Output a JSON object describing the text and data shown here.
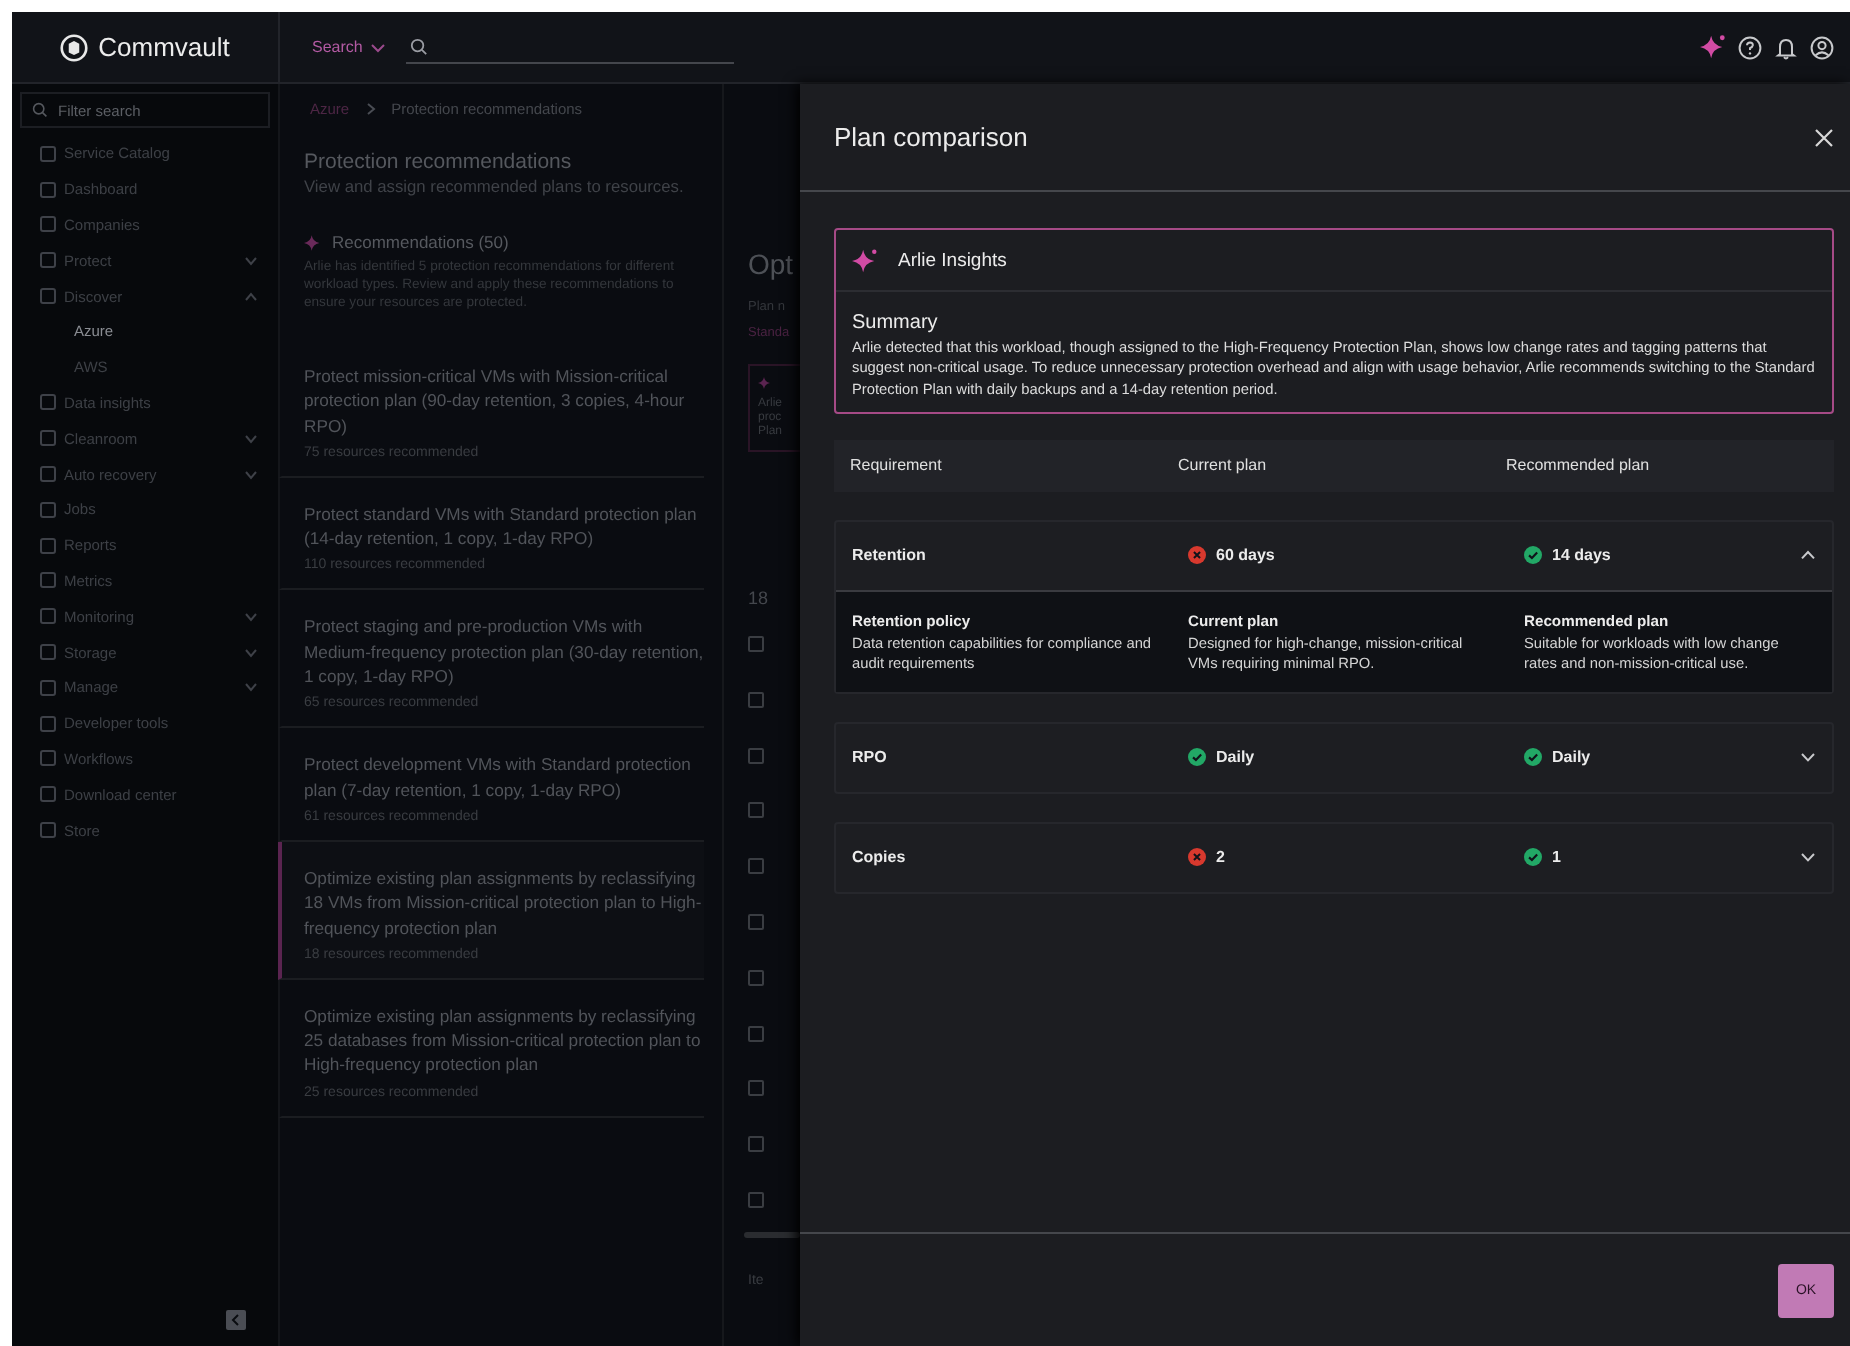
{
  "topbar": {
    "logo": "Commvault",
    "search_scope": "Search"
  },
  "sidebar": {
    "filter": {
      "placeholder": "Filter search"
    },
    "items": [
      {
        "label": "Service Catalog",
        "selected": false
      },
      {
        "label": "Dashboard",
        "selected": false
      },
      {
        "label": "Companies",
        "selected": false
      },
      {
        "label": "Protect",
        "selected": false,
        "expanded": false
      },
      {
        "label": "Discover",
        "selected": false,
        "expanded": true,
        "children": [
          {
            "label": "Azure",
            "selected": true
          },
          {
            "label": "AWS",
            "selected": false
          }
        ]
      },
      {
        "label": "Data insights",
        "selected": false
      },
      {
        "label": "Cleanroom",
        "selected": false,
        "expanded": false
      },
      {
        "label": "Auto recovery",
        "selected": false,
        "expanded": false
      },
      {
        "label": "Jobs",
        "selected": false
      },
      {
        "label": "Reports",
        "selected": false
      },
      {
        "label": "Metrics",
        "selected": false
      },
      {
        "label": "Monitoring",
        "selected": false,
        "expanded": false
      },
      {
        "label": "Storage",
        "selected": false,
        "expanded": false
      },
      {
        "label": "Manage",
        "selected": false,
        "expanded": false
      },
      {
        "label": "Developer tools",
        "selected": false
      },
      {
        "label": "Workflows",
        "selected": false
      },
      {
        "label": "Download center",
        "selected": false
      },
      {
        "label": "Store",
        "selected": false
      }
    ]
  },
  "breadcrumb": [
    "Azure",
    "Protection recommendations"
  ],
  "page": {
    "title": "Protection recommendations",
    "subtitle": "View and assign recommended plans to resources."
  },
  "recommendations": {
    "title": "Recommendations (50)",
    "description": "Arlie has identified 5 protection recommendations for different workload types. Review and apply these recommendations to ensure your resources are protected.",
    "items": [
      {
        "title": "Protect mission-critical VMs with Mission-critical protection plan (90-day retention, 3 copies, 4-hour RPO)",
        "count": "75 resources recommended",
        "selected": false
      },
      {
        "title": "Protect standard VMs with Standard protection plan (14-day retention, 1 copy, 1-day RPO)",
        "count": "110 resources recommended",
        "selected": false
      },
      {
        "title": "Protect staging and pre-production VMs with Medium-frequency protection plan (30-day retention, 1 copy, 1-day RPO)",
        "count": "65 resources recommended",
        "selected": false
      },
      {
        "title": "Protect development VMs with Standard protection plan (7-day retention, 1 copy, 1-day RPO)",
        "count": "61 resources recommended",
        "selected": false
      },
      {
        "title": "Optimize existing plan assignments by reclassifying 18 VMs from Mission-critical protection plan to High-frequency protection plan",
        "count": "18 resources recommended",
        "selected": true
      },
      {
        "title": "Optimize existing plan assignments by reclassifying 25 databases from Mission-critical protection plan to High-frequency protection plan",
        "count": "25 resources recommended",
        "selected": false
      }
    ]
  },
  "detail_peek": {
    "title": "Opt",
    "plan_label": "Plan n",
    "plan_value": "Standa",
    "insight_lines": [
      "Arlie",
      "proc",
      "Plan"
    ],
    "count": "18",
    "checkboxes": [
      {
        "checked": false
      },
      {
        "checked": false
      },
      {
        "checked": false
      },
      {
        "checked": false
      },
      {
        "checked": false
      },
      {
        "checked": false
      },
      {
        "checked": false
      },
      {
        "checked": false
      },
      {
        "checked": false
      },
      {
        "checked": false
      },
      {
        "checked": false
      }
    ],
    "footer": "Ite"
  },
  "drawer": {
    "title": "Plan comparison",
    "insights": {
      "title": "Arlie Insights",
      "summary_title": "Summary",
      "summary": "Arlie detected that this workload, though assigned to the High-Frequency Protection Plan, shows low change rates and tagging patterns that suggest non-critical usage. To reduce unnecessary protection overhead and align with usage behavior, Arlie recommends switching to the Standard Protection Plan with daily backups and a 14-day retention period."
    },
    "columns": [
      "Requirement",
      "Current plan",
      "Recommended plan"
    ],
    "rows": [
      {
        "name": "Retention",
        "current": {
          "value": "60 days",
          "meets": false
        },
        "recommended": {
          "value": "14 days",
          "meets": true
        },
        "expanded": true,
        "details": [
          {
            "title": "Retention policy",
            "text": "Data retention capabilities for compliance and audit requirements"
          },
          {
            "title": "Current plan",
            "text": "Designed for high-change, mission-critical VMs requiring minimal RPO."
          },
          {
            "title": "Recommended plan",
            "text": "Suitable for workloads with low change rates and non-mission-critical use."
          }
        ]
      },
      {
        "name": "RPO",
        "current": {
          "value": "Daily",
          "meets": true
        },
        "recommended": {
          "value": "Daily",
          "meets": true
        },
        "expanded": false
      },
      {
        "name": "Copies",
        "current": {
          "value": "2",
          "meets": false
        },
        "recommended": {
          "value": "1",
          "meets": true
        },
        "expanded": false
      }
    ],
    "ok_button": "OK"
  }
}
